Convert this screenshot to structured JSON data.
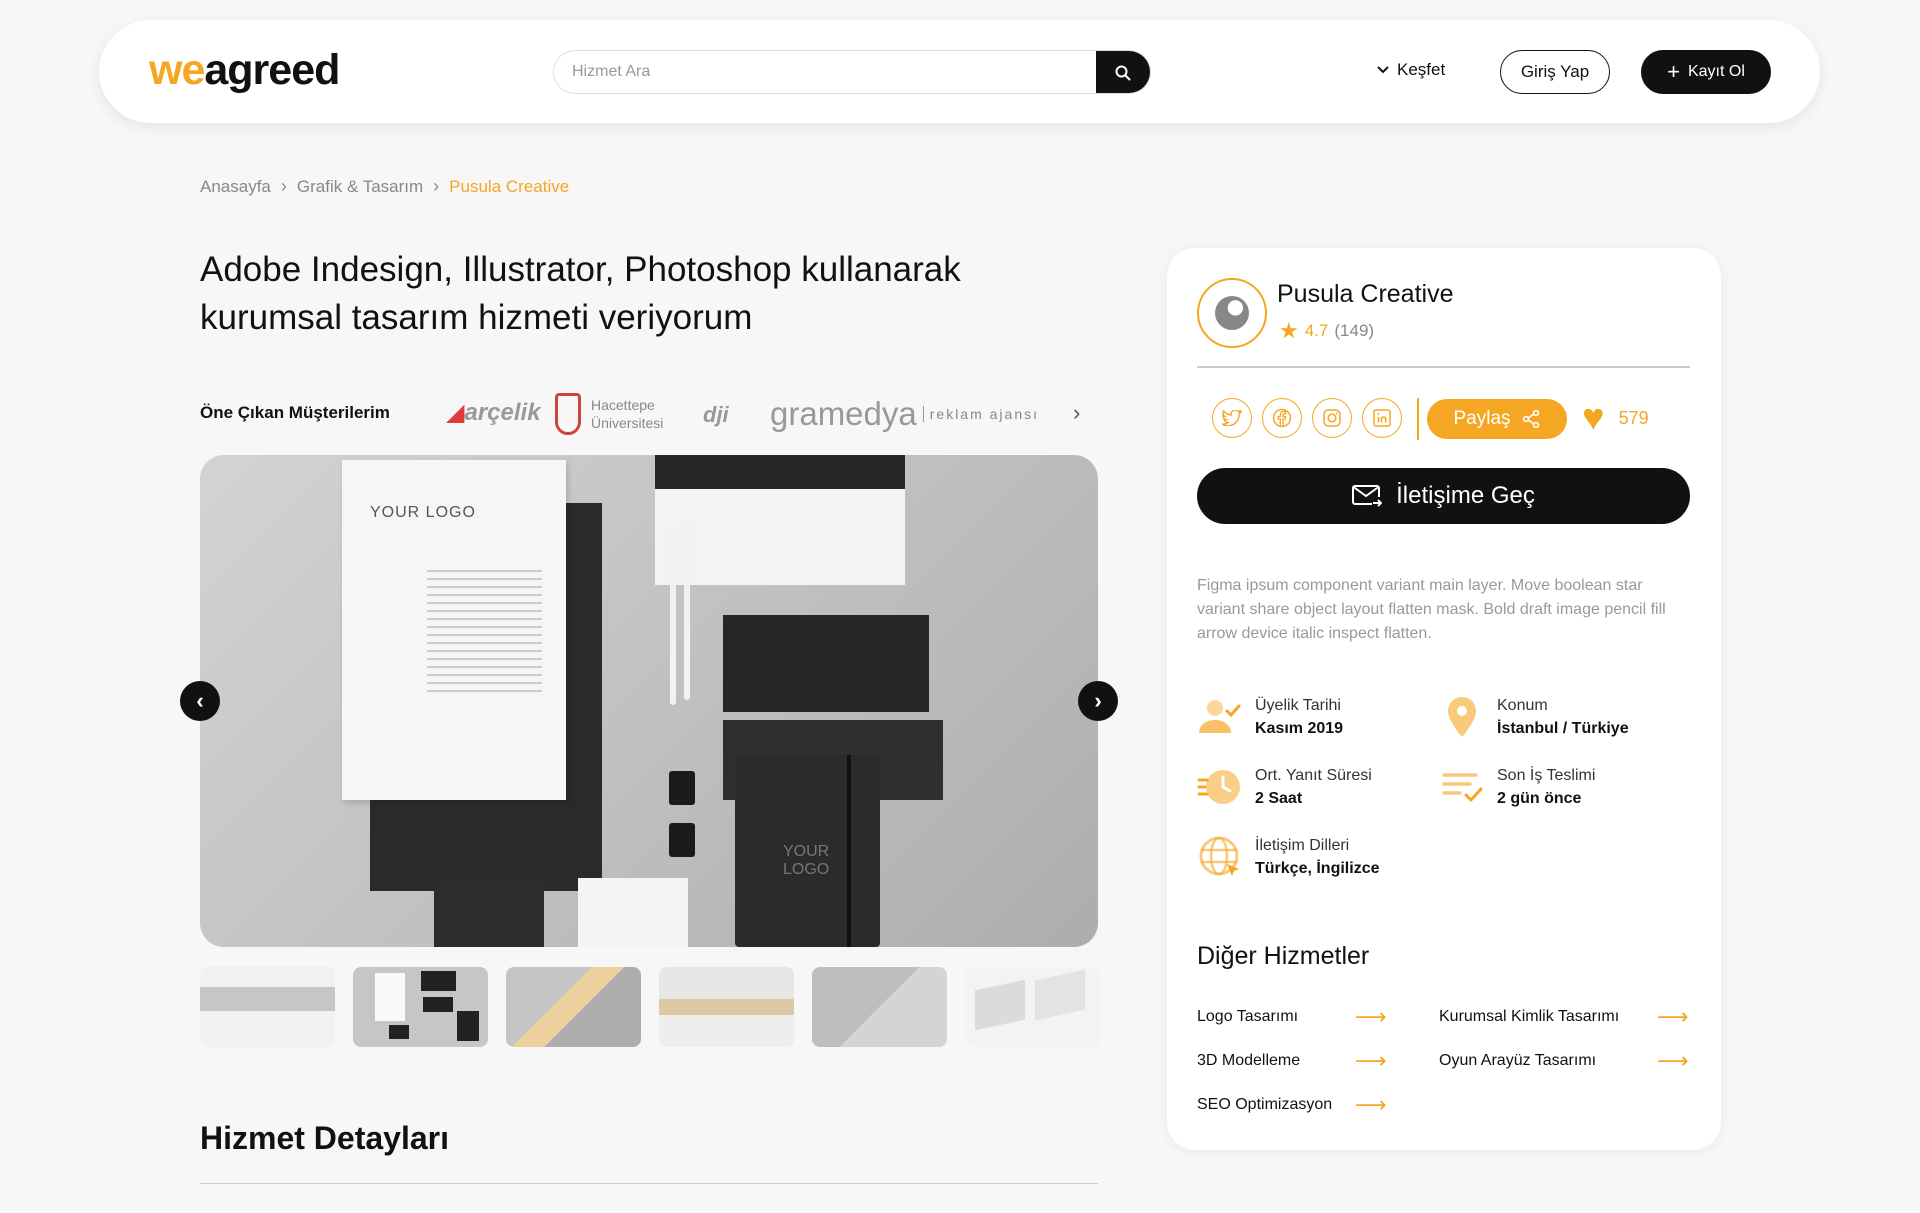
{
  "header": {
    "logo_we": "we",
    "logo_agreed": "agreed",
    "search_placeholder": "Hizmet Ara",
    "explore_label": "Keşfet",
    "login_label": "Giriş Yap",
    "register_label": "Kayıt Ol"
  },
  "breadcrumb": {
    "items": [
      "Anasayfa",
      "Grafik & Tasarım"
    ],
    "current": "Pusula Creative"
  },
  "service": {
    "title": "Adobe Indesign, Illustrator, Photoshop kullanarak kurumsal tasarım hizmeti veriyorum",
    "clients_label": "Öne Çıkan Müşterilerim",
    "clients": {
      "arcelik": "arçelik",
      "hacettepe_1": "Hacettepe",
      "hacettepe_2": "Üniversitesi",
      "dji": "dji",
      "gramedya": "gramedya",
      "gramedya_sub": "reklam ajansı"
    },
    "gallery": {
      "letter_logo": "YOUR LOGO",
      "notebook_logo_1": "YOUR",
      "notebook_logo_2": "LOGO",
      "thumbnail_count": 6,
      "active_thumbnail": 2
    },
    "details_title": "Hizmet Detayları"
  },
  "seller": {
    "name": "Pusula Creative",
    "rating": "4.7",
    "review_count": "(149)",
    "share_label": "Paylaş",
    "likes": "579",
    "contact_label": "İletişime Geç",
    "description": "Figma ipsum component variant main layer. Move boolean star variant share object layout flatten mask. Bold draft image pencil fill arrow device italic inspect flatten.",
    "info": {
      "member_since_label": "Üyelik Tarihi",
      "member_since": "Kasım 2019",
      "location_label": "Konum",
      "location": "İstanbul / Türkiye",
      "response_label": "Ort. Yanıt Süresi",
      "response": "2 Saat",
      "last_delivery_label": "Son İş Teslimi",
      "last_delivery": "2 gün önce",
      "languages_label": "İletişim Dilleri",
      "languages": "Türkçe, İngilizce"
    },
    "other_title": "Diğer Hizmetler",
    "other_services": [
      "Logo Tasarımı",
      "Kurumsal Kimlik Tasarımı",
      "3D Modelleme",
      "Oyun Arayüz Tasarımı",
      "SEO Optimizasyon"
    ]
  },
  "colors": {
    "accent": "#f5a623",
    "dark": "#111111",
    "background": "#f7f7f7"
  }
}
